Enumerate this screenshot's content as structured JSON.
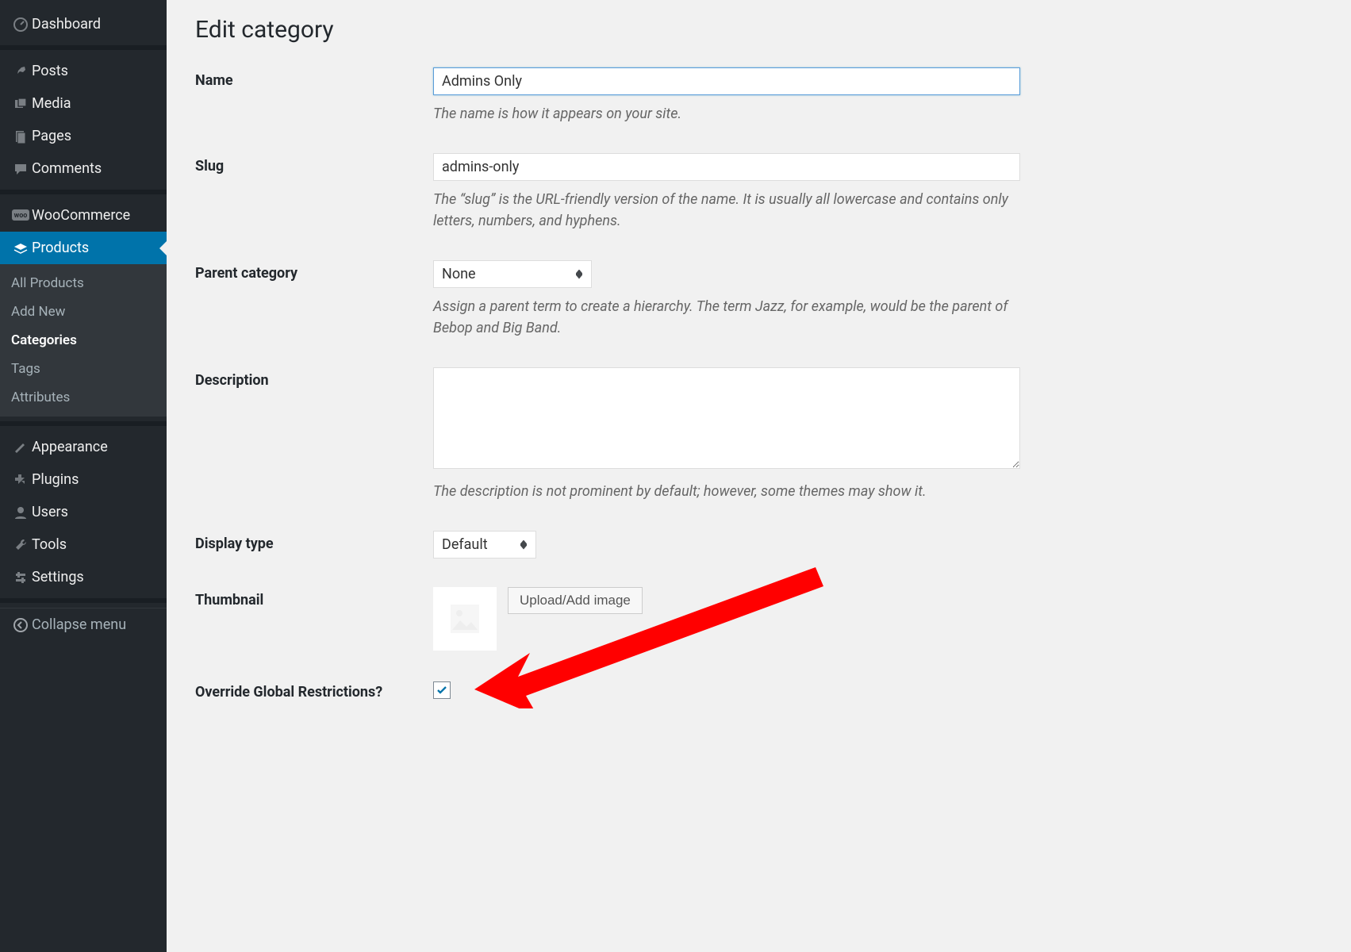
{
  "sidebar": {
    "items": [
      {
        "icon": "dashboard-icon",
        "label": "Dashboard"
      },
      {
        "icon": "pin-icon",
        "label": "Posts"
      },
      {
        "icon": "media-icon",
        "label": "Media"
      },
      {
        "icon": "pages-icon",
        "label": "Pages"
      },
      {
        "icon": "comments-icon",
        "label": "Comments"
      },
      {
        "icon": "woo-icon",
        "label": "WooCommerce"
      },
      {
        "icon": "products-icon",
        "label": "Products",
        "active": true
      }
    ],
    "submenu": [
      {
        "label": "All Products"
      },
      {
        "label": "Add New"
      },
      {
        "label": "Categories",
        "current": true
      },
      {
        "label": "Tags"
      },
      {
        "label": "Attributes"
      }
    ],
    "after_items": [
      {
        "icon": "appearance-icon",
        "label": "Appearance"
      },
      {
        "icon": "plugins-icon",
        "label": "Plugins"
      },
      {
        "icon": "users-icon",
        "label": "Users"
      },
      {
        "icon": "tools-icon",
        "label": "Tools"
      },
      {
        "icon": "settings-icon",
        "label": "Settings"
      }
    ],
    "collapse_label": "Collapse menu"
  },
  "page": {
    "title": "Edit category",
    "fields": {
      "name": {
        "label": "Name",
        "value": "Admins Only",
        "help": "The name is how it appears on your site."
      },
      "slug": {
        "label": "Slug",
        "value": "admins-only",
        "help": "The “slug” is the URL-friendly version of the name. It is usually all lowercase and contains only letters, numbers, and hyphens."
      },
      "parent": {
        "label": "Parent category",
        "value": "None",
        "help": "Assign a parent term to create a hierarchy. The term Jazz, for example, would be the parent of Bebop and Big Band."
      },
      "description": {
        "label": "Description",
        "value": "",
        "help": "The description is not prominent by default; however, some themes may show it."
      },
      "display_type": {
        "label": "Display type",
        "value": "Default"
      },
      "thumbnail": {
        "label": "Thumbnail",
        "upload_button": "Upload/Add image"
      },
      "override": {
        "label": "Override Global Restrictions?",
        "checked": true
      }
    }
  }
}
